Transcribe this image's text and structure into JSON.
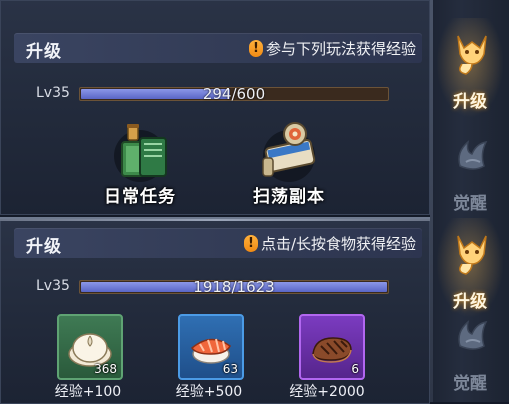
{
  "upper": {
    "header_title": "升级",
    "hint_icon": "warning-exclamation-icon",
    "hint_text": "参与下列玩法获得经验",
    "level_label": "Lv35",
    "exp_text": "294/600",
    "exp_progress": 0.49,
    "activities": [
      {
        "icon": "medicine-bottle-book-icon",
        "label": "日常任务"
      },
      {
        "icon": "scroll-map-icon",
        "label": "扫荡副本"
      }
    ]
  },
  "lower": {
    "header_title": "升级",
    "hint_icon": "warning-exclamation-icon",
    "hint_text": "点击/长按食物获得经验",
    "level_label": "Lv35",
    "exp_text": "1918/1623",
    "exp_progress": 1.0,
    "foods": [
      {
        "icon": "steamed-bun-icon",
        "count": "368",
        "exp": "经验+100",
        "rarity_color": "#3f7a54"
      },
      {
        "icon": "salmon-sushi-icon",
        "count": "63",
        "exp": "经验+500",
        "rarity_color": "#2f6fb3"
      },
      {
        "icon": "steak-icon",
        "count": "6",
        "exp": "经验+2000",
        "rarity_color": "#7b3bc0"
      }
    ]
  },
  "side_tabs": [
    {
      "icon": "fox-spirit-icon",
      "label": "升级",
      "active": true
    },
    {
      "icon": "awaken-wing-icon",
      "label": "觉醒",
      "active": false
    },
    {
      "icon": "fox-spirit-icon",
      "label": "升级",
      "active": true
    },
    {
      "icon": "awaken-wing-icon",
      "label": "觉醒",
      "active": false
    }
  ],
  "colors": {
    "exp_bar_fill": "#6f7ad8",
    "active_tab_glow": "#d08a1f",
    "warning": "#f59a1f"
  }
}
